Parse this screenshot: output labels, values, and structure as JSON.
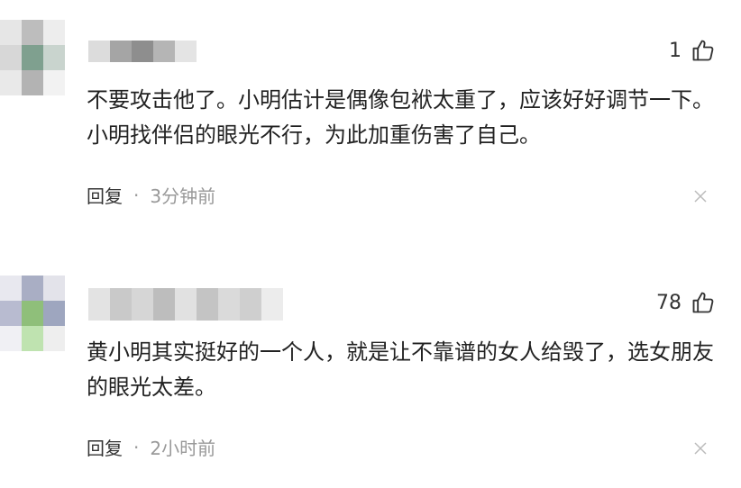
{
  "comments": [
    {
      "like_count": "1",
      "text": "不要攻击他了。小明估计是偶像包袱太重了，应该好好调节一下。小明找伴侣的眼光不行，为此加重伤害了自己。",
      "reply_label": "回复",
      "separator": "·",
      "time": "3分钟前",
      "icons": {
        "like": "thumbs-up-icon",
        "close": "close-icon"
      }
    },
    {
      "like_count": "78",
      "text": "黄小明其实挺好的一个人，就是让不靠谱的女人给毁了，选女朋友的眼光太差。",
      "reply_label": "回复",
      "separator": "·",
      "time": "2小时前",
      "icons": {
        "like": "thumbs-up-icon",
        "close": "close-icon"
      }
    }
  ],
  "colors": {
    "text": "#222222",
    "meta": "#999999",
    "background": "#ffffff"
  }
}
